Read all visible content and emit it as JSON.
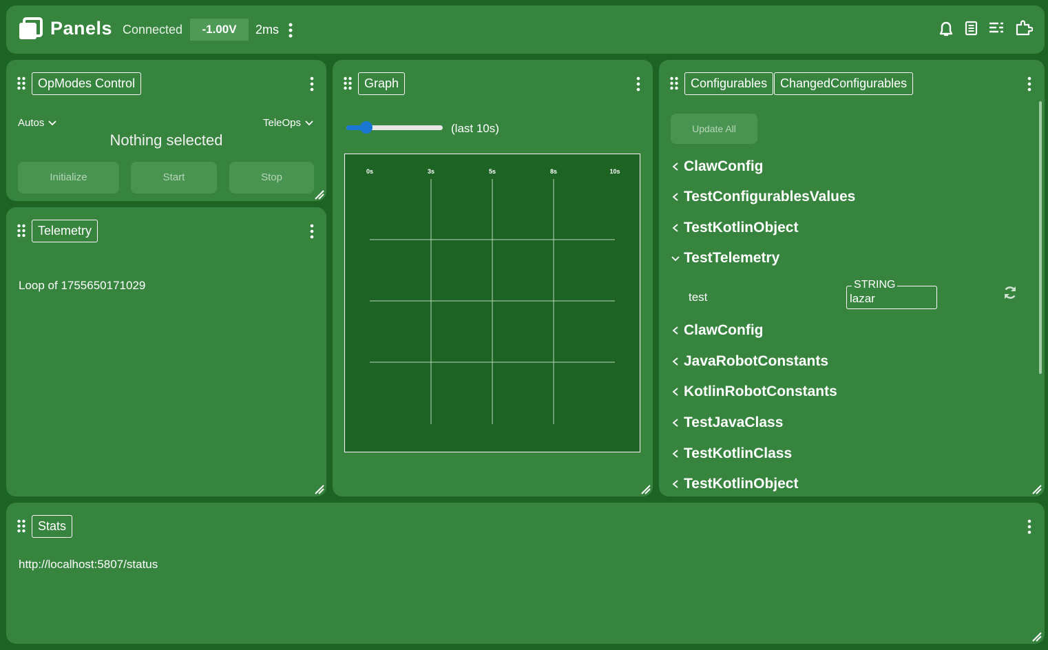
{
  "header": {
    "title": "Panels",
    "connection": "Connected",
    "voltage": "-1.00V",
    "latency": "2ms"
  },
  "opmodes": {
    "tab": "OpModes Control",
    "autos_label": "Autos",
    "teleops_label": "TeleOps",
    "status": "Nothing selected",
    "buttons": {
      "initialize": "Initialize",
      "start": "Start",
      "stop": "Stop"
    }
  },
  "telemetry": {
    "tab": "Telemetry",
    "line": "Loop of 1755650171029"
  },
  "graph": {
    "tab": "Graph",
    "range_label": "(last 10s)",
    "slider_fraction": 0.15
  },
  "chart_data": {
    "type": "line",
    "x_ticks": [
      "0s",
      "3s",
      "5s",
      "8s",
      "10s"
    ],
    "series": [],
    "grid": true
  },
  "config": {
    "tabs": [
      "Configurables",
      "ChangedConfigurables"
    ],
    "update_all": "Update All",
    "items": [
      {
        "label": "ClawConfig",
        "expanded": false
      },
      {
        "label": "TestConfigurablesValues",
        "expanded": false
      },
      {
        "label": "TestKotlinObject",
        "expanded": false
      },
      {
        "label": "TestTelemetry",
        "expanded": true
      },
      {
        "label": "ClawConfig",
        "expanded": false
      },
      {
        "label": "JavaRobotConstants",
        "expanded": false
      },
      {
        "label": "KotlinRobotConstants",
        "expanded": false
      },
      {
        "label": "TestJavaClass",
        "expanded": false
      },
      {
        "label": "TestKotlinClass",
        "expanded": false
      },
      {
        "label": "TestKotlinObject",
        "expanded": false
      }
    ],
    "field": {
      "name": "test",
      "type": "STRING",
      "value": "lazar"
    }
  },
  "stats": {
    "tab": "Stats",
    "url": "http://localhost:5807/status"
  },
  "colors": {
    "background": "#1d6424",
    "card": "#37843f",
    "accent": "#1976d2"
  }
}
